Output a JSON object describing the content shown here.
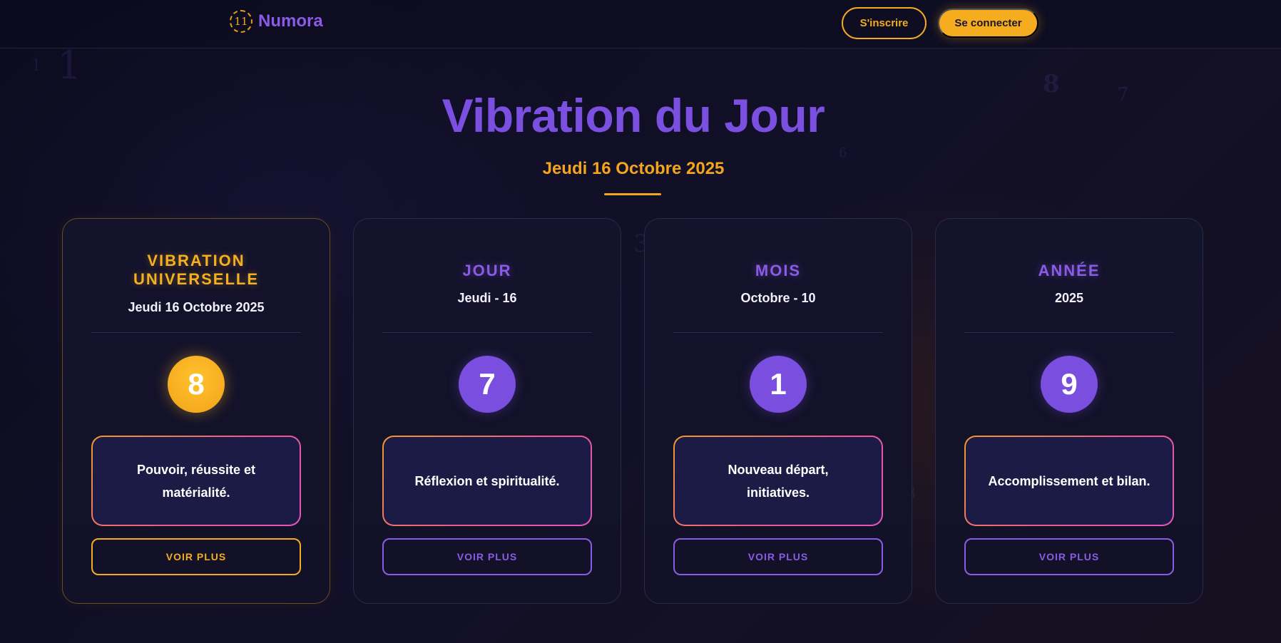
{
  "header": {
    "logo_glyph": "11",
    "brand": "Numora",
    "signup_label": "S'inscrire",
    "login_label": "Se connecter"
  },
  "hero": {
    "title": "Vibration du Jour",
    "date": "Jeudi 16 Octobre 2025"
  },
  "background_digits": [
    "1",
    "1",
    "8",
    "7",
    "6",
    "3",
    "8"
  ],
  "cards": [
    {
      "title": "VIBRATION UNIVERSELLE",
      "subtitle": "Jeudi 16 Octobre 2025",
      "number": "8",
      "description": "Pouvoir, réussite et matérialité.",
      "button_label": "VOIR PLUS",
      "accent": "#f5ac1e"
    },
    {
      "title": "JOUR",
      "subtitle": "Jeudi - 16",
      "number": "7",
      "description": "Réflexion et spiritualité.",
      "button_label": "VOIR PLUS",
      "accent": "#8a5ce6"
    },
    {
      "title": "MOIS",
      "subtitle": "Octobre - 10",
      "number": "1",
      "description": "Nouveau départ, initiatives.",
      "button_label": "VOIR PLUS",
      "accent": "#8a5ce6"
    },
    {
      "title": "ANNÉE",
      "subtitle": "2025",
      "number": "9",
      "description": "Accomplissement et bilan.",
      "button_label": "VOIR PLUS",
      "accent": "#8a5ce6"
    }
  ],
  "colors": {
    "background": "#0c0b1e",
    "primary_purple": "#7b4fe0",
    "accent_orange": "#f5ac1e",
    "card_background": "#14132c",
    "gradient_border_start": "#f29a2c",
    "gradient_border_end": "#e356c0"
  }
}
